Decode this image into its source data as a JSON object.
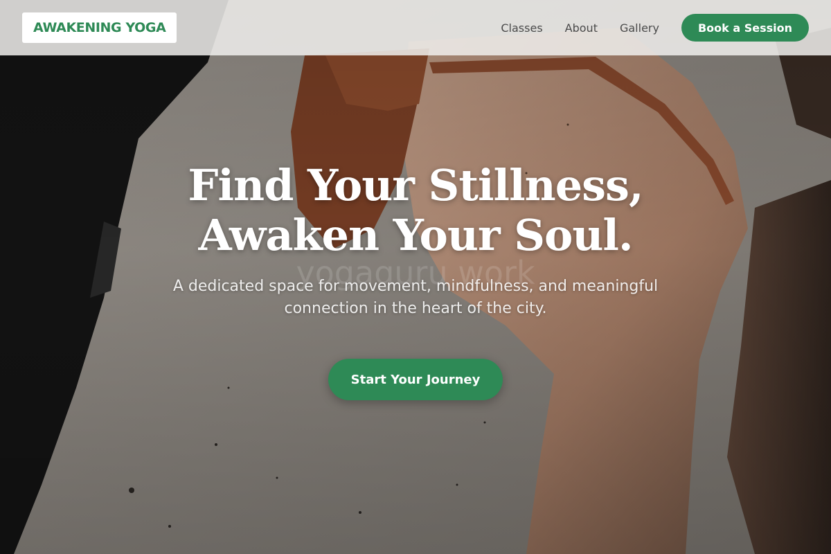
{
  "brand": {
    "logo_text": "AWAKENING YOGA"
  },
  "nav": {
    "items": [
      {
        "label": "Classes"
      },
      {
        "label": "About"
      },
      {
        "label": "Gallery"
      }
    ],
    "cta_label": "Book a Session"
  },
  "hero": {
    "headline_line1": "Find Your Stillness,",
    "headline_line2": "Awaken Your Soul.",
    "watermark": "yogaguru work",
    "subtitle": "A dedicated space for movement, mindfulness, and meaningful connection in the heart of the city.",
    "cta_label": "Start Your Journey"
  },
  "colors": {
    "accent": "#2e8a56",
    "header_bg": "#f0efec",
    "text_dark": "#4a4a4a",
    "wall": "#8c8781",
    "skin": "#b08870",
    "garment": "#8a4a2e"
  }
}
